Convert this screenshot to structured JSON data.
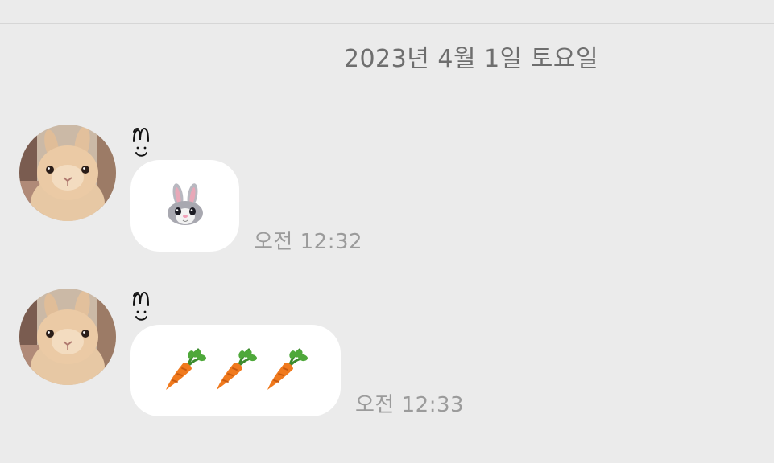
{
  "date_header": "2023년 4월 1일 토요일",
  "messages": [
    {
      "sender_avatar": "bunny-photo",
      "sender_name_glyph": "m-smile",
      "content_icons": [
        "bunny-face-icon"
      ],
      "time": "오전 12:32"
    },
    {
      "sender_avatar": "bunny-photo",
      "sender_name_glyph": "m-smile",
      "content_icons": [
        "carrot-icon",
        "carrot-icon",
        "carrot-icon"
      ],
      "time": "오전 12:33"
    }
  ],
  "colors": {
    "background": "#ebebeb",
    "bubble": "#ffffff",
    "date_text": "#6e6e6e",
    "time_text": "#9b9b9b"
  }
}
